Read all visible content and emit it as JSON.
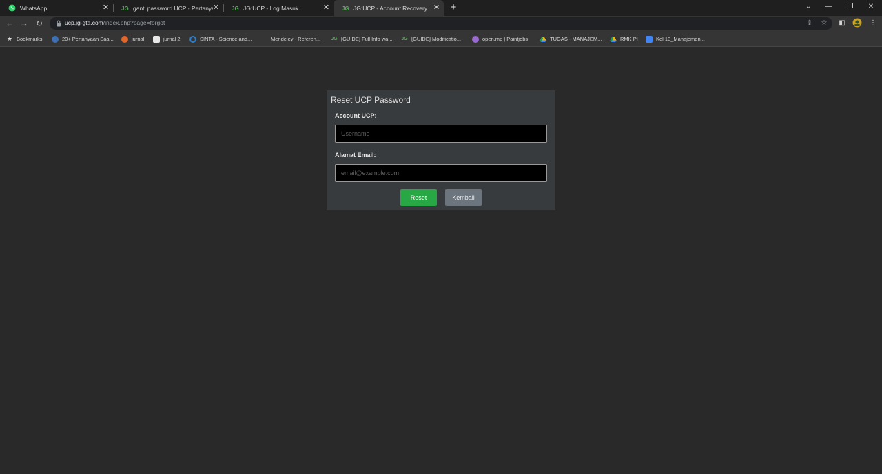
{
  "tabs": [
    {
      "title": "WhatsApp",
      "favicon": "whatsapp-icon",
      "active": false
    },
    {
      "title": "ganti password UCP - Pertanyaan",
      "favicon": "jg-gta-icon",
      "active": false
    },
    {
      "title": "JG:UCP - Log Masuk",
      "favicon": "jg-gta-icon",
      "active": false
    },
    {
      "title": "JG:UCP - Account Recovery",
      "favicon": "jg-gta-icon",
      "active": true
    }
  ],
  "address": {
    "host": "ucp.jg-gta.com",
    "path": "/index.php?page=forgot"
  },
  "bookmarks": [
    {
      "label": "Bookmarks",
      "icon": "star-icon"
    },
    {
      "label": "20+ Pertanyaan Saa...",
      "icon": "globe-icon"
    },
    {
      "label": "jurnal",
      "icon": "journal-icon"
    },
    {
      "label": "jurnal 2",
      "icon": "document-icon"
    },
    {
      "label": "SINTA - Science and...",
      "icon": "sinta-icon"
    },
    {
      "label": "Mendeley - Referen...",
      "icon": "mendeley-icon"
    },
    {
      "label": "[GUIDE] Full Info wa...",
      "icon": "jg-gta-icon"
    },
    {
      "label": "[GUIDE] Modificatio...",
      "icon": "jg-gta-icon"
    },
    {
      "label": "open.mp | Paintjobs",
      "icon": "openmp-icon"
    },
    {
      "label": "TUGAS - MANAJEM...",
      "icon": "drive-icon"
    },
    {
      "label": "RMK PI",
      "icon": "drive-icon"
    },
    {
      "label": "Kel 13_Manajemen...",
      "icon": "docs-icon"
    }
  ],
  "form": {
    "title": "Reset UCP Password",
    "account_label": "Account UCP:",
    "account_placeholder": "Username",
    "email_label": "Alamat Email:",
    "email_placeholder": "email@example.com",
    "reset_label": "Reset",
    "back_label": "Kembali"
  },
  "colors": {
    "reset_button": "#28a745",
    "back_button": "#6c757d",
    "panel": "#383b3d",
    "page_bg": "#292929"
  }
}
